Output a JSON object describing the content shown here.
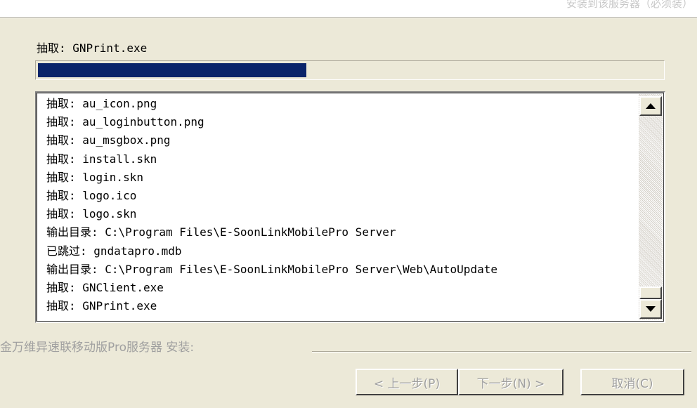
{
  "header": {
    "subtitle": "安装到该服务器（必须装）"
  },
  "status": {
    "label": "抽取: GNPrint.exe"
  },
  "progress": {
    "fraction": 0.43,
    "fill_color": "#0a246a"
  },
  "log": {
    "lines": [
      "抽取: au_icon.png",
      "抽取: au_loginbutton.png",
      "抽取: au_msgbox.png",
      "抽取: install.skn",
      "抽取: login.skn",
      "抽取: logo.ico",
      "抽取: logo.skn",
      "输出目录: C:\\Program Files\\E-SoonLinkMobilePro Server",
      "已跳过: gndatapro.mdb",
      "输出目录: C:\\Program Files\\E-SoonLinkMobilePro Server\\Web\\AutoUpdate",
      "抽取: GNClient.exe",
      "抽取: GNPrint.exe"
    ],
    "scroll_up_icon": "triangle-up",
    "scroll_down_icon": "triangle-down"
  },
  "footer": {
    "group_label": "金万维异速联移动版Pro服务器 安装:"
  },
  "buttons": {
    "back": "< 上一步(P)",
    "next": "下一步(N) >",
    "cancel": "取消(C)"
  }
}
